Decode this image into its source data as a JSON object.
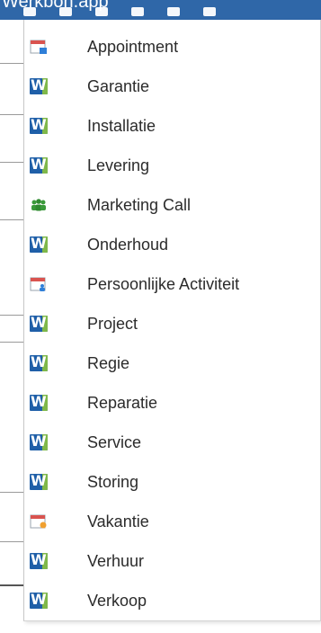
{
  "toolbar": {
    "title": "Werkbon.app",
    "icons": [
      "print-icon",
      "inbox-icon",
      "document-icon",
      "people-icon",
      "at-icon",
      "user-icon"
    ]
  },
  "menu": {
    "items": [
      {
        "label": "Appointment",
        "icon": "calendar-icon"
      },
      {
        "label": "Garantie",
        "icon": "w-icon"
      },
      {
        "label": "Installatie",
        "icon": "w-icon"
      },
      {
        "label": "Levering",
        "icon": "w-icon"
      },
      {
        "label": "Marketing Call",
        "icon": "people-icon"
      },
      {
        "label": "Onderhoud",
        "icon": "w-icon"
      },
      {
        "label": "Persoonlijke Activiteit",
        "icon": "calendar-person-icon"
      },
      {
        "label": "Project",
        "icon": "w-icon"
      },
      {
        "label": "Regie",
        "icon": "w-icon"
      },
      {
        "label": "Reparatie",
        "icon": "w-icon"
      },
      {
        "label": "Service",
        "icon": "w-icon"
      },
      {
        "label": "Storing",
        "icon": "w-icon"
      },
      {
        "label": "Vakantie",
        "icon": "calendar-vacation-icon"
      },
      {
        "label": "Verhuur",
        "icon": "w-icon"
      },
      {
        "label": "Verkoop",
        "icon": "w-icon"
      }
    ]
  },
  "colors": {
    "toolbar_bg": "#2f67a8",
    "w_blue": "#1f5fa8",
    "w_green": "#7fb84a",
    "people_green": "#3a9a3a",
    "calendar_red": "#d9534f",
    "calendar_blue": "#2f7fd8",
    "vacation_orange": "#f0a030",
    "text": "#2b2b2b"
  }
}
